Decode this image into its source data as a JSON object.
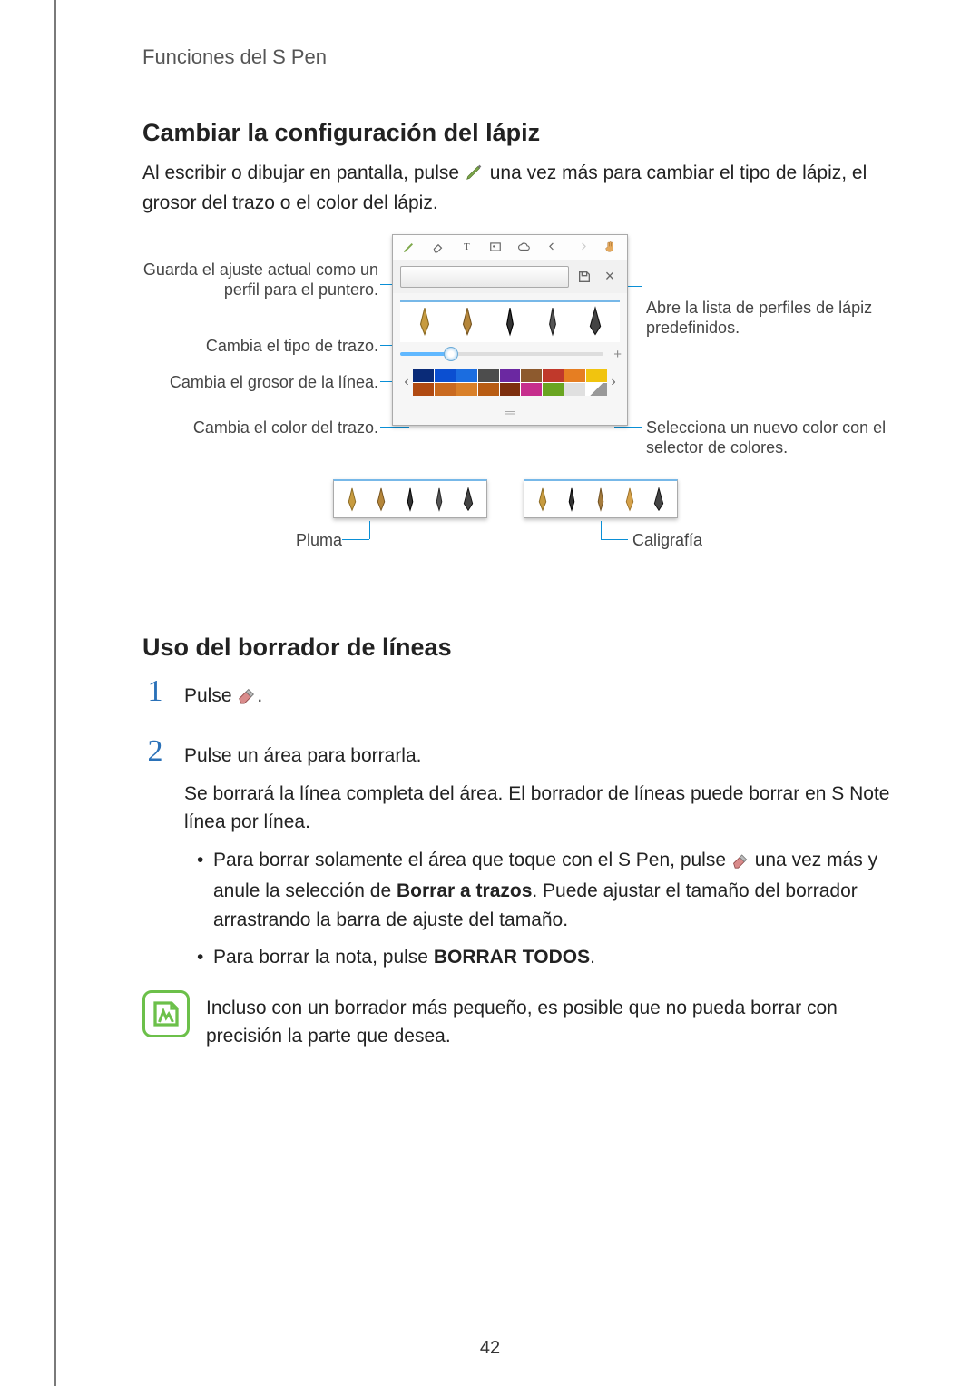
{
  "header": "Funciones del S Pen",
  "section1": {
    "title": "Cambiar la configuración del lápiz",
    "intro_before": "Al escribir o dibujar en pantalla, pulse ",
    "intro_after": " una vez más para cambiar el tipo de lápiz, el grosor del trazo o el color del lápiz."
  },
  "figure": {
    "callout_left_1": "Guarda el ajuste actual como un perfil para el puntero.",
    "callout_left_2": "Cambia el tipo de trazo.",
    "callout_left_3": "Cambia el grosor de la línea.",
    "callout_left_4": "Cambia el color del trazo.",
    "callout_right_1": "Abre la lista de perfiles de lápiz predefinidos.",
    "callout_right_2": "Selecciona un nuevo color con el selector de colores.",
    "label_left_strip": "Pluma",
    "label_right_strip": "Caligrafía",
    "toolbar_icons": [
      "pen-icon",
      "eraser-icon",
      "text-icon",
      "image-icon",
      "cloud-icon",
      "undo-icon",
      "redo-icon",
      "hand-icon"
    ],
    "colors_row1": [
      "#0a2b78",
      "#0b4fd1",
      "#1b6de0",
      "#4d4d4d",
      "#6b28a1",
      "#8d5a2e",
      "#c0392b",
      "#e67e22",
      "#f1c40f"
    ],
    "colors_row2": [
      "#b04a12",
      "#c96a20",
      "#d98029",
      "#b85c13",
      "#7d2f0e",
      "#c62e8d",
      "#6aa521",
      "#e0e0e0"
    ],
    "picker_symbol": "◢"
  },
  "section2": {
    "title": "Uso del borrador de líneas",
    "step1": "Pulse ",
    "step1_after": ".",
    "step2_a": "Pulse un área para borrarla.",
    "step2_b": "Se borrará la línea completa del área. El borrador de líneas puede borrar en S Note línea por línea.",
    "bullet1_before": "Para borrar solamente el área que toque con el S Pen, pulse ",
    "bullet1_after_a": " una vez más y anule la selección de ",
    "bullet1_bold": "Borrar a trazos",
    "bullet1_after_b": ". Puede ajustar el tamaño del borrador arrastrando la barra de ajuste del tamaño.",
    "bullet2_before": "Para borrar la nota, pulse ",
    "bullet2_bold": "BORRAR TODOS",
    "bullet2_after": ".",
    "note": "Incluso con un borrador más pequeño, es posible que no pueda borrar con precisión la parte que desea."
  },
  "page_number": "42"
}
